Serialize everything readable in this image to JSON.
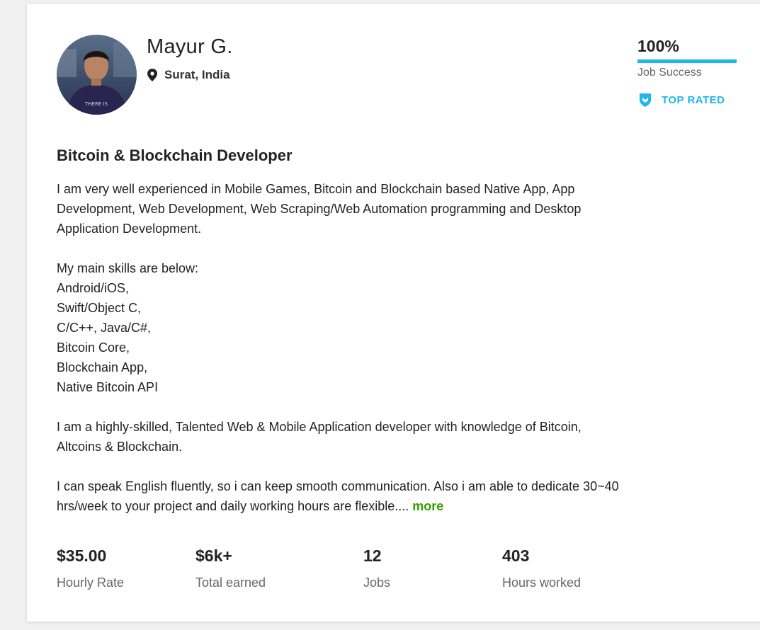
{
  "profile": {
    "name": "Mayur G.",
    "location": "Surat, India",
    "avatar_icon": "profile-photo",
    "shirt_text": "THERE IS"
  },
  "job_success": {
    "percent_text": "100%",
    "percent_value": 100,
    "label": "Job Success",
    "bar_color": "#1fb6e8"
  },
  "badge": {
    "label": "TOP RATED",
    "icon": "shield-badge-icon",
    "color": "#1fb6e8"
  },
  "title": "Bitcoin & Blockchain Developer",
  "description": {
    "intro_lines": [
      "I am very well experienced in Mobile Games, Bitcoin and Blockchain based Native App, App",
      "Development, Web Development, Web Scraping/Web Automation programming and Desktop",
      "Application Development."
    ],
    "skills_lines": [
      "My main skills are below:",
      "Android/iOS,",
      "Swift/Object C,",
      "C/C++, Java/C#,",
      "Bitcoin Core,",
      "Blockchain App,",
      "Native Bitcoin API"
    ],
    "talent_lines": [
      "I am a highly-skilled, Talented Web & Mobile Application developer with knowledge of Bitcoin,",
      "Altcoins & Blockchain."
    ],
    "closing_line_1": "I can speak English fluently, so i can keep smooth communication. Also i am able to dedicate 30~40",
    "closing_line_2": "hrs/week to your project and daily working hours are flexible....",
    "more_link": "more",
    "more_color": "#37a000"
  },
  "stats": [
    {
      "value": "$35.00",
      "label": "Hourly Rate"
    },
    {
      "value": "$6k+",
      "label": "Total earned"
    },
    {
      "value": "12",
      "label": "Jobs"
    },
    {
      "value": "403",
      "label": "Hours worked"
    }
  ]
}
